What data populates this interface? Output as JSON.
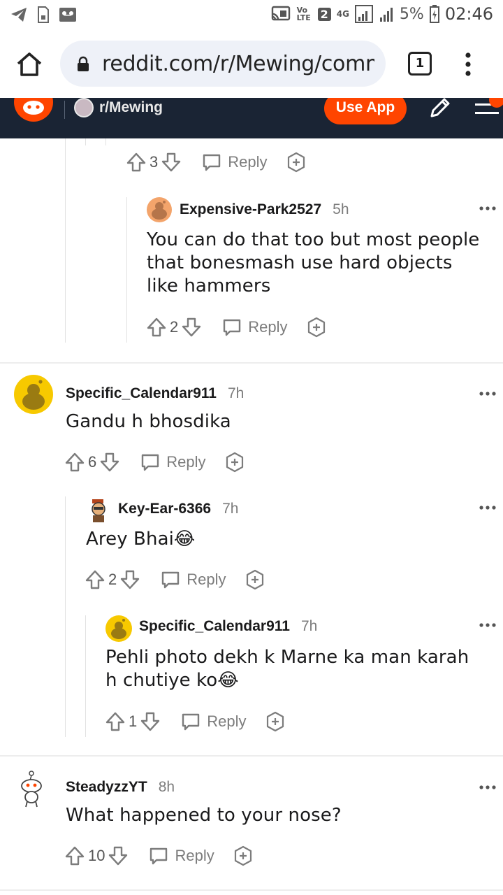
{
  "status_bar": {
    "network_label": "VoLTE",
    "sim": "2",
    "net_type": "4G",
    "battery": "5%",
    "time": "02:46"
  },
  "browser": {
    "url": "reddit.com/r/Mewing/comm",
    "tab_count": "1"
  },
  "reddit_header": {
    "subreddit": "r/Mewing",
    "use_app_label": "Use App"
  },
  "comments": [
    {
      "id": "c0",
      "score": "3",
      "reply_label": "Reply"
    },
    {
      "id": "c1",
      "user": "Expensive-Park2527",
      "time": "5h",
      "body": "You can do that too but most people that bonesmash use hard objects like hammers",
      "score": "2",
      "reply_label": "Reply"
    },
    {
      "id": "c2",
      "user": "Specific_Calendar911",
      "time": "7h",
      "body": "Gandu h bhosdika",
      "score": "6",
      "reply_label": "Reply"
    },
    {
      "id": "c3",
      "user": "Key-Ear-6366",
      "time": "7h",
      "body": "Arey Bhai😂",
      "score": "2",
      "reply_label": "Reply"
    },
    {
      "id": "c4",
      "user": "Specific_Calendar911",
      "time": "7h",
      "body": "Pehli photo dekh k Marne ka man karah h chutiye ko😂",
      "score": "1",
      "reply_label": "Reply"
    },
    {
      "id": "c5",
      "user": "SteadyzzYT",
      "time": "8h",
      "body": "What happened to your nose?",
      "score": "10",
      "reply_label": "Reply"
    }
  ],
  "colors": {
    "reddit_orange": "#ff4500",
    "header_bg": "#1a2434",
    "meta_gray": "#7c7c7c"
  }
}
